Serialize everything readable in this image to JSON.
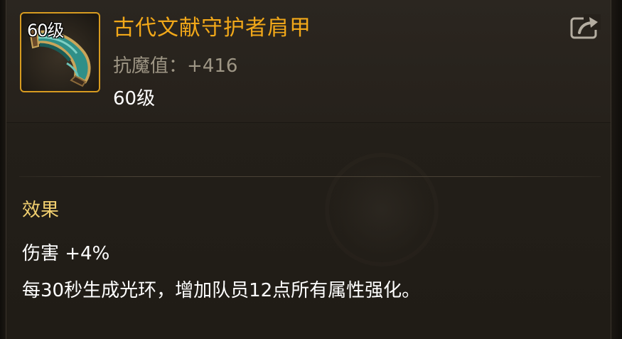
{
  "item": {
    "level_badge": "60级",
    "name": "古代文献守护者肩甲",
    "stat_line": "抗魔值：+416",
    "level_text": "60级",
    "icon": "shoulder-armor-icon"
  },
  "header": {
    "share_icon": "share-external-icon"
  },
  "effects": {
    "title": "效果",
    "lines": [
      "伤害 +4%",
      "每30秒生成光环，增加队员12点所有属性强化。"
    ]
  },
  "colors": {
    "title": "#f2a819",
    "frame_border": "#d79b20",
    "section_title": "#f1cf6f",
    "stat_text": "#9e9685",
    "body_text": "#ffffff"
  }
}
